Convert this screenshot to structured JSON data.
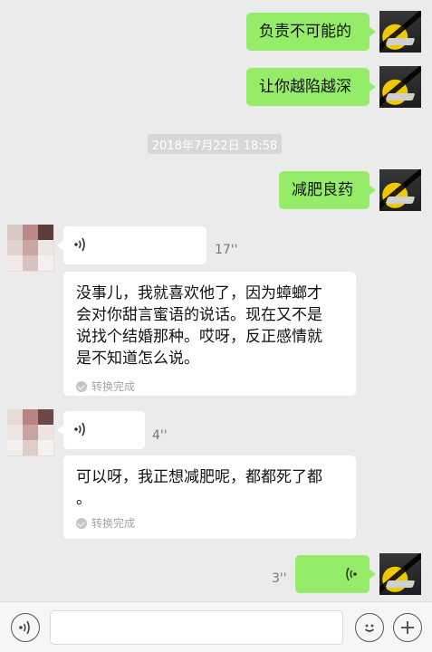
{
  "messages": {
    "m1": "负责不可能的",
    "m2": "让你越陷越深",
    "timestamp": "2018年7月22日 18:58",
    "m3": "减肥良药",
    "voice1_duration": "17''",
    "transcript1": "没事儿，我就喜欢他了，因为蟑螂才\n会对你甜言蜜语的说话。现在又不是\n说找个结婚那种。哎呀，反正感情就\n是不知道怎么说。",
    "transcript_done": "转换完成",
    "voice2_duration": "4''",
    "transcript2": "可以呀，我正想减肥呢，都都死了都\n。",
    "voice3_duration": "3''"
  },
  "icons": {
    "voice": "voice-wave-icon",
    "check": "check-icon",
    "emoji": "emoji-icon",
    "plus": "plus-icon",
    "voice_input": "voice-input-icon"
  },
  "colors": {
    "sent_bubble": "#95ec69",
    "received_bubble": "#ffffff",
    "background": "#ebebeb"
  }
}
